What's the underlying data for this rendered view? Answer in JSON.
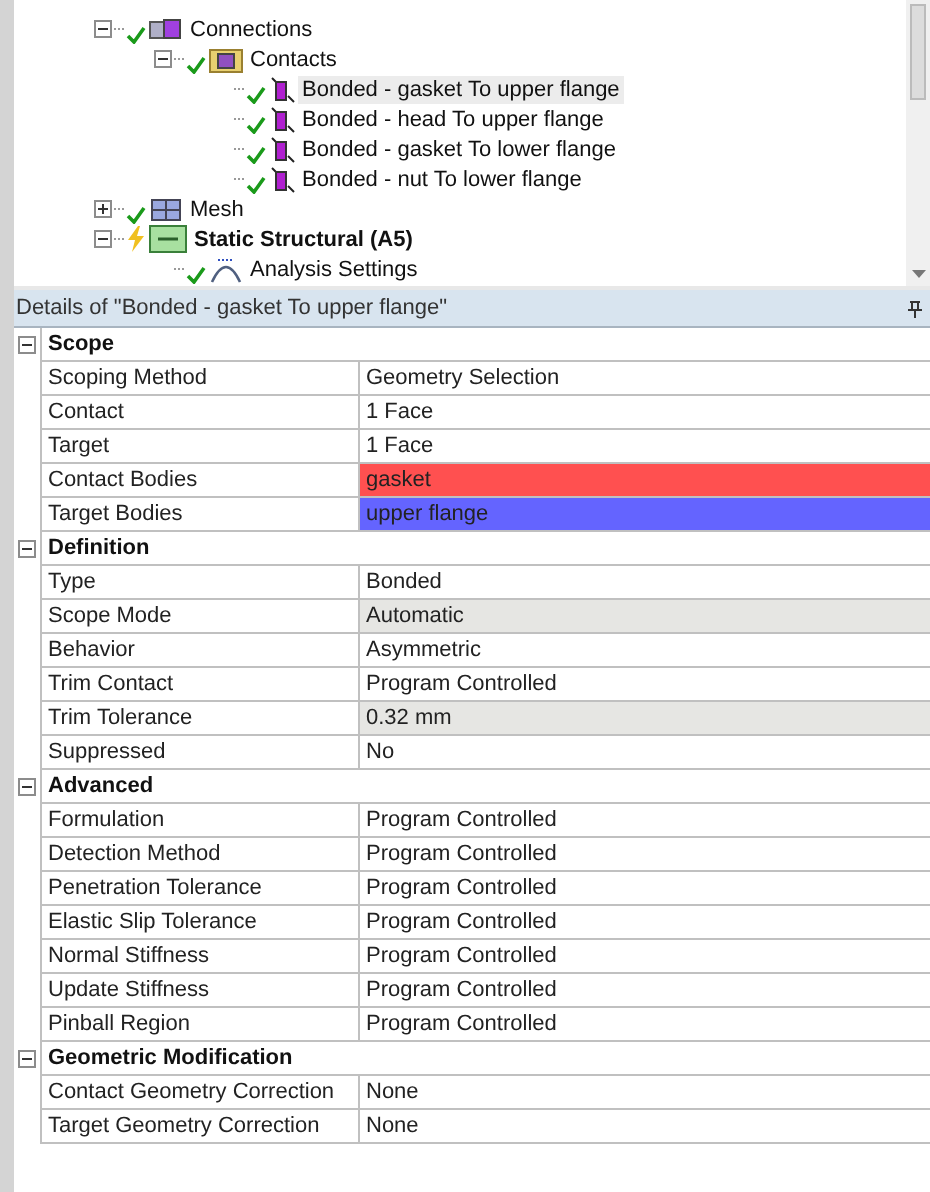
{
  "tree": {
    "items": [
      {
        "label": "Connections",
        "kind": "connections",
        "up_to_date": true,
        "expanded": true,
        "selected": false,
        "children": [
          {
            "label": "Contacts",
            "kind": "contacts",
            "up_to_date": true,
            "expanded": true,
            "selected": false,
            "children": [
              {
                "label": "Bonded - gasket To upper flange",
                "kind": "contact",
                "up_to_date": true,
                "selected": true
              },
              {
                "label": "Bonded - head To upper flange",
                "kind": "contact",
                "up_to_date": true,
                "selected": false
              },
              {
                "label": "Bonded - gasket To lower flange",
                "kind": "contact",
                "up_to_date": true,
                "selected": false
              },
              {
                "label": "Bonded - nut To lower flange",
                "kind": "contact",
                "up_to_date": true,
                "selected": false
              }
            ]
          }
        ]
      },
      {
        "label": "Mesh",
        "kind": "mesh",
        "up_to_date": true,
        "expanded": false,
        "selected": false
      },
      {
        "label": "Static Structural (A5)",
        "kind": "analysis",
        "up_to_date": false,
        "expanded": true,
        "bold": true,
        "selected": false,
        "children": [
          {
            "label": "Analysis Settings",
            "kind": "settings",
            "up_to_date": true,
            "selected": false
          }
        ]
      }
    ]
  },
  "details": {
    "title": "Details of \"Bonded - gasket To upper flange\"",
    "sections": [
      {
        "title": "Scope",
        "expanded": true,
        "rows": [
          {
            "name": "Scoping Method",
            "value": "Geometry Selection",
            "readonly": false
          },
          {
            "name": "Contact",
            "value": "1 Face",
            "readonly": false
          },
          {
            "name": "Target",
            "value": "1 Face",
            "readonly": false
          },
          {
            "name": "Contact Bodies",
            "value": "gasket",
            "readonly": false,
            "color": "#ff5050"
          },
          {
            "name": "Target Bodies",
            "value": "upper flange",
            "readonly": false,
            "color": "#6464ff"
          }
        ]
      },
      {
        "title": "Definition",
        "expanded": true,
        "rows": [
          {
            "name": "Type",
            "value": "Bonded",
            "readonly": false
          },
          {
            "name": "Scope Mode",
            "value": "Automatic",
            "readonly": true
          },
          {
            "name": "Behavior",
            "value": "Asymmetric",
            "readonly": false
          },
          {
            "name": "Trim Contact",
            "value": "Program Controlled",
            "readonly": false
          },
          {
            "name": "Trim Tolerance",
            "value": "0.32 mm",
            "readonly": true
          },
          {
            "name": "Suppressed",
            "value": "No",
            "readonly": false
          }
        ]
      },
      {
        "title": "Advanced",
        "expanded": true,
        "rows": [
          {
            "name": "Formulation",
            "value": "Program Controlled",
            "readonly": false
          },
          {
            "name": "Detection Method",
            "value": "Program Controlled",
            "readonly": false
          },
          {
            "name": "Penetration Tolerance",
            "value": "Program Controlled",
            "readonly": false
          },
          {
            "name": "Elastic Slip Tolerance",
            "value": "Program Controlled",
            "readonly": false
          },
          {
            "name": "Normal Stiffness",
            "value": "Program Controlled",
            "readonly": false
          },
          {
            "name": "Update Stiffness",
            "value": "Program Controlled",
            "readonly": false
          },
          {
            "name": "Pinball Region",
            "value": "Program Controlled",
            "readonly": false
          }
        ]
      },
      {
        "title": "Geometric Modification",
        "expanded": true,
        "rows": [
          {
            "name": "Contact Geometry Correction",
            "value": "None",
            "readonly": false
          },
          {
            "name": "Target Geometry Correction",
            "value": "None",
            "readonly": false
          }
        ]
      }
    ]
  }
}
